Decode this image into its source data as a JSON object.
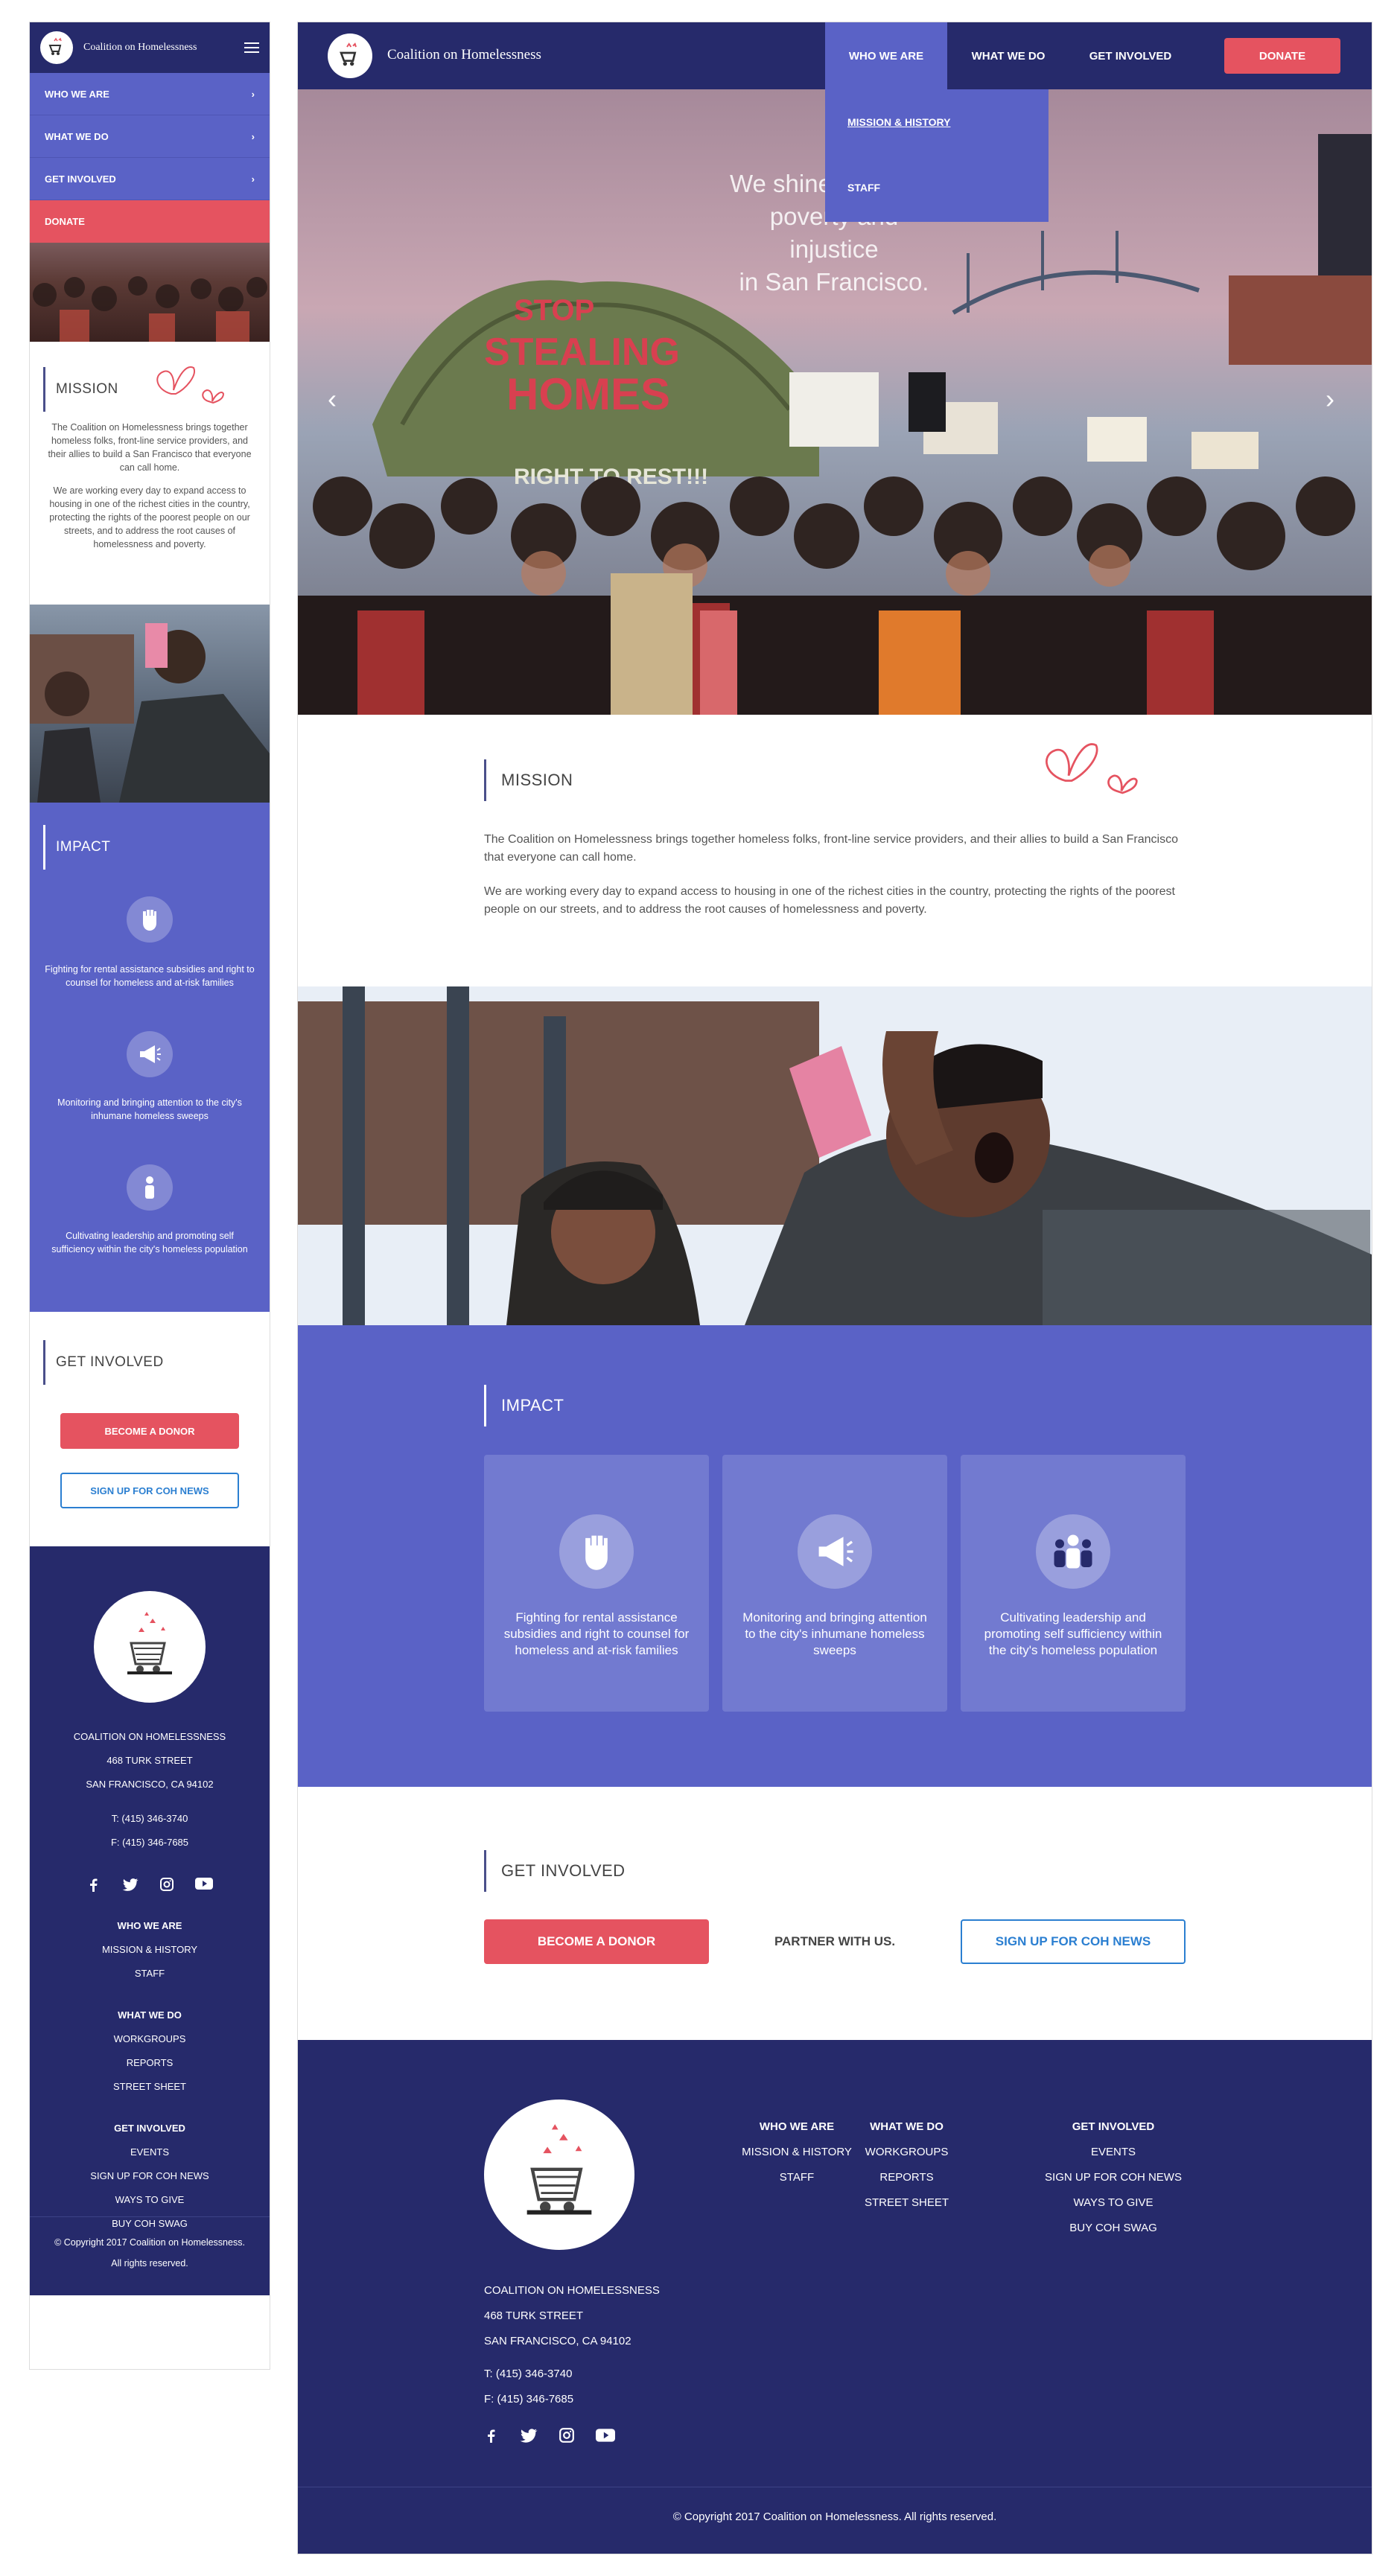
{
  "brand": {
    "name": "Coalition on Homelessness"
  },
  "nav": {
    "items": [
      {
        "label": "WHO WE ARE"
      },
      {
        "label": "WHAT WE DO"
      },
      {
        "label": "GET INVOLVED"
      }
    ],
    "donate": "DONATE",
    "dropdown": [
      "MISSION & HISTORY",
      "STAFF"
    ]
  },
  "hero": {
    "tagline": [
      "We shine a light on",
      "poverty and injustice",
      "in San Francisco."
    ],
    "prev_icon": "chevron-left-icon",
    "next_icon": "chevron-right-icon"
  },
  "mission": {
    "title": "MISSION",
    "p1": "The Coalition on Homelessness brings together homeless folks, front-line service providers, and their allies to build a San Francisco that everyone can call home.",
    "p2": "We are working every day to expand access to housing in one of the richest cities in the country, protecting the rights of the poorest people on our streets, and to address the root causes of homelessness and poverty."
  },
  "impact": {
    "title": "IMPACT",
    "items": [
      {
        "icon": "fist-icon",
        "text": "Fighting for rental assistance subsidies and right to counsel for homeless and at-risk families"
      },
      {
        "icon": "megaphone-icon",
        "text": "Monitoring and bringing attention to the city's inhumane homeless sweeps"
      },
      {
        "icon": "people-icon",
        "text": "Cultivating leadership and promoting self sufficiency within the city's homeless population"
      }
    ]
  },
  "get_involved": {
    "title": "GET INVOLVED",
    "donor_btn": "BECOME A DONOR",
    "partner": "PARTNER WITH US.",
    "news_btn": "SIGN UP FOR COH NEWS"
  },
  "footer": {
    "org": "COALITION ON HOMELESSNESS",
    "street": "468 TURK STREET",
    "city": "SAN FRANCISCO, CA 94102",
    "phone": "T: (415) 346-3740",
    "fax": "F: (415) 346-7685",
    "social": [
      "facebook-icon",
      "twitter-icon",
      "instagram-icon",
      "youtube-icon"
    ],
    "columns": [
      {
        "heading": "WHO WE ARE",
        "links": [
          "MISSION & HISTORY",
          "STAFF"
        ]
      },
      {
        "heading": "WHAT WE DO",
        "links": [
          "WORKGROUPS",
          "REPORTS",
          "STREET SHEET"
        ]
      },
      {
        "heading": "GET INVOLVED",
        "links": [
          "EVENTS",
          "SIGN UP FOR COH NEWS",
          "WAYS TO GIVE",
          "BUY COH SWAG"
        ]
      }
    ],
    "copyright": "© Copyright 2017 Coalition on Homelessness.  All rights reserved.",
    "copyright_m1": "© Copyright 2017 Coalition on Homelessness.",
    "copyright_m2": "All rights reserved."
  },
  "colors": {
    "navy": "#262a6b",
    "periwinkle": "#5a62c6",
    "red": "#e55360",
    "blue": "#2b7fd1"
  }
}
